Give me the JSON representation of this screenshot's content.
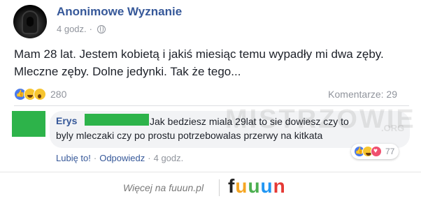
{
  "post": {
    "page_name": "Anonimowe Wyznanie",
    "time": "4 godz.",
    "separator": "·",
    "text": "Mam 28 lat. Jestem kobietą i jakiś miesiąc temu wypadły mi dwa zęby. Mleczne zęby. Dolne jedynki. Tak że tego...",
    "reactions_icons": [
      "like-icon",
      "haha-icon",
      "wow-icon"
    ],
    "reactions_count": "280",
    "comments_label": "Komentarze: 29"
  },
  "comment": {
    "author": "Erys",
    "line1": "Jak bedziesz miala 29lat to sie dowiesz czy to",
    "line2": "byly mleczaki czy po prostu potrzebowalas przerwy na kitkata",
    "like_label": "Lubię to!",
    "reply_label": "Odpowiedz",
    "time": "4 godz.",
    "separator": "·",
    "reactions_icons": [
      "like-icon",
      "haha-icon",
      "love-icon"
    ],
    "reactions_count": "77"
  },
  "watermark": {
    "text": "MISTRZOWIE",
    "sub": ".ORG"
  },
  "footer": {
    "text": "Więcej na fuuun.pl",
    "logo_letters": [
      "f",
      "u",
      "u",
      "u",
      "n"
    ]
  },
  "colors": {
    "link_blue": "#365899",
    "redact_green": "#2db34a",
    "meta_gray": "#90949c"
  }
}
